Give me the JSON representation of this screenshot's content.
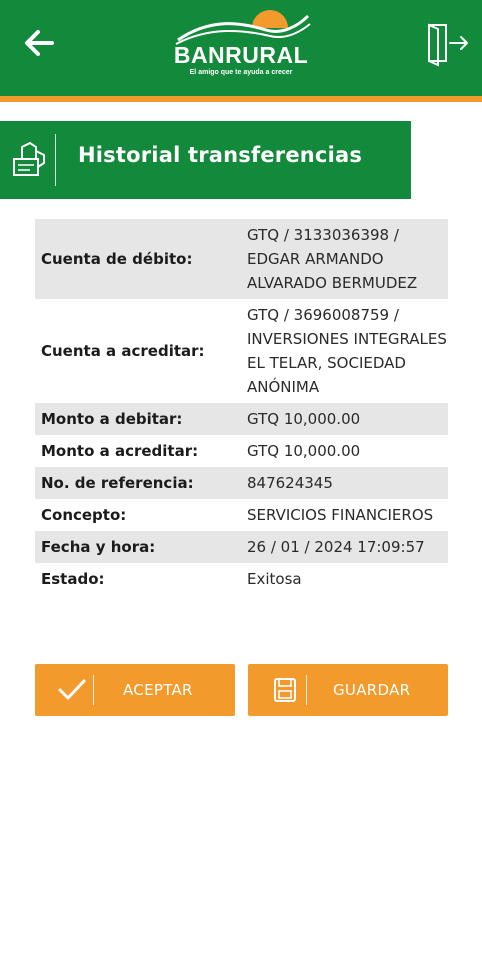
{
  "header": {
    "logo_text": "BANRURAL",
    "logo_tagline": "El amigo que te ayuda a crecer",
    "back_icon": "arrow-left-icon",
    "exit_icon": "logout-door-icon",
    "colors": {
      "primary": "#138a3b",
      "accent": "#f39a2c"
    }
  },
  "section": {
    "title": "Historial transferencias",
    "icon": "receipt-hand-icon"
  },
  "details": [
    {
      "label": "Cuenta de débito:",
      "lines": [
        "GTQ / 3133036398 /",
        "EDGAR ARMANDO",
        "ALVARADO BERMUDEZ"
      ]
    },
    {
      "label": "Cuenta a acreditar:",
      "lines": [
        "GTQ / 3696008759 /",
        "INVERSIONES INTEGRALES",
        "EL TELAR, SOCIEDAD",
        "ANÓNIMA"
      ]
    },
    {
      "label": "Monto a debitar:",
      "lines": [
        "GTQ 10,000.00"
      ]
    },
    {
      "label": "Monto a acreditar:",
      "lines": [
        "GTQ 10,000.00"
      ]
    },
    {
      "label": "No. de referencia:",
      "lines": [
        "847624345"
      ]
    },
    {
      "label": "Concepto:",
      "lines": [
        "SERVICIOS FINANCIEROS"
      ]
    },
    {
      "label": "Fecha y hora:",
      "lines": [
        "26 / 01 / 2024 17:09:57"
      ]
    },
    {
      "label": "Estado:",
      "lines": [
        "Exitosa"
      ]
    }
  ],
  "actions": {
    "accept_label": "ACEPTAR",
    "accept_icon": "checkmark-icon",
    "save_label": "GUARDAR",
    "save_icon": "floppy-disk-icon"
  }
}
